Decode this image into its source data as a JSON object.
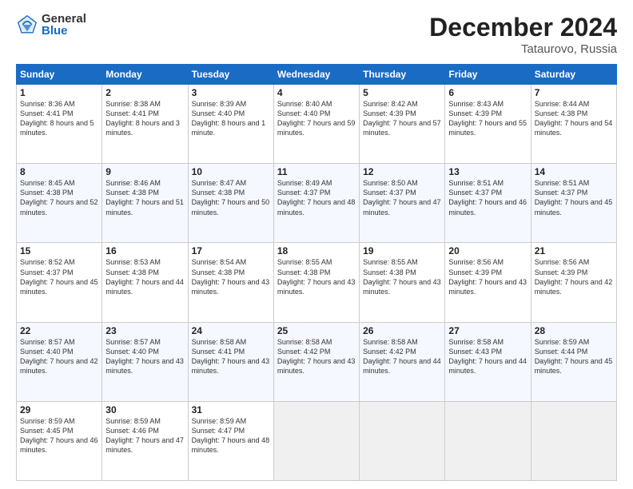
{
  "header": {
    "title": "December 2024",
    "subtitle": "Tataurovo, Russia",
    "logo_general": "General",
    "logo_blue": "Blue"
  },
  "days_of_week": [
    "Sunday",
    "Monday",
    "Tuesday",
    "Wednesday",
    "Thursday",
    "Friday",
    "Saturday"
  ],
  "weeks": [
    [
      {
        "day": "1",
        "sunrise": "8:36 AM",
        "sunset": "4:41 PM",
        "daylight": "8 hours and 5 minutes."
      },
      {
        "day": "2",
        "sunrise": "8:38 AM",
        "sunset": "4:41 PM",
        "daylight": "8 hours and 3 minutes."
      },
      {
        "day": "3",
        "sunrise": "8:39 AM",
        "sunset": "4:40 PM",
        "daylight": "8 hours and 1 minute."
      },
      {
        "day": "4",
        "sunrise": "8:40 AM",
        "sunset": "4:40 PM",
        "daylight": "7 hours and 59 minutes."
      },
      {
        "day": "5",
        "sunrise": "8:42 AM",
        "sunset": "4:39 PM",
        "daylight": "7 hours and 57 minutes."
      },
      {
        "day": "6",
        "sunrise": "8:43 AM",
        "sunset": "4:39 PM",
        "daylight": "7 hours and 55 minutes."
      },
      {
        "day": "7",
        "sunrise": "8:44 AM",
        "sunset": "4:38 PM",
        "daylight": "7 hours and 54 minutes."
      }
    ],
    [
      {
        "day": "8",
        "sunrise": "8:45 AM",
        "sunset": "4:38 PM",
        "daylight": "7 hours and 52 minutes."
      },
      {
        "day": "9",
        "sunrise": "8:46 AM",
        "sunset": "4:38 PM",
        "daylight": "7 hours and 51 minutes."
      },
      {
        "day": "10",
        "sunrise": "8:47 AM",
        "sunset": "4:38 PM",
        "daylight": "7 hours and 50 minutes."
      },
      {
        "day": "11",
        "sunrise": "8:49 AM",
        "sunset": "4:37 PM",
        "daylight": "7 hours and 48 minutes."
      },
      {
        "day": "12",
        "sunrise": "8:50 AM",
        "sunset": "4:37 PM",
        "daylight": "7 hours and 47 minutes."
      },
      {
        "day": "13",
        "sunrise": "8:51 AM",
        "sunset": "4:37 PM",
        "daylight": "7 hours and 46 minutes."
      },
      {
        "day": "14",
        "sunrise": "8:51 AM",
        "sunset": "4:37 PM",
        "daylight": "7 hours and 45 minutes."
      }
    ],
    [
      {
        "day": "15",
        "sunrise": "8:52 AM",
        "sunset": "4:37 PM",
        "daylight": "7 hours and 45 minutes."
      },
      {
        "day": "16",
        "sunrise": "8:53 AM",
        "sunset": "4:38 PM",
        "daylight": "7 hours and 44 minutes."
      },
      {
        "day": "17",
        "sunrise": "8:54 AM",
        "sunset": "4:38 PM",
        "daylight": "7 hours and 43 minutes."
      },
      {
        "day": "18",
        "sunrise": "8:55 AM",
        "sunset": "4:38 PM",
        "daylight": "7 hours and 43 minutes."
      },
      {
        "day": "19",
        "sunrise": "8:55 AM",
        "sunset": "4:38 PM",
        "daylight": "7 hours and 43 minutes."
      },
      {
        "day": "20",
        "sunrise": "8:56 AM",
        "sunset": "4:39 PM",
        "daylight": "7 hours and 43 minutes."
      },
      {
        "day": "21",
        "sunrise": "8:56 AM",
        "sunset": "4:39 PM",
        "daylight": "7 hours and 42 minutes."
      }
    ],
    [
      {
        "day": "22",
        "sunrise": "8:57 AM",
        "sunset": "4:40 PM",
        "daylight": "7 hours and 42 minutes."
      },
      {
        "day": "23",
        "sunrise": "8:57 AM",
        "sunset": "4:40 PM",
        "daylight": "7 hours and 43 minutes."
      },
      {
        "day": "24",
        "sunrise": "8:58 AM",
        "sunset": "4:41 PM",
        "daylight": "7 hours and 43 minutes."
      },
      {
        "day": "25",
        "sunrise": "8:58 AM",
        "sunset": "4:42 PM",
        "daylight": "7 hours and 43 minutes."
      },
      {
        "day": "26",
        "sunrise": "8:58 AM",
        "sunset": "4:42 PM",
        "daylight": "7 hours and 44 minutes."
      },
      {
        "day": "27",
        "sunrise": "8:58 AM",
        "sunset": "4:43 PM",
        "daylight": "7 hours and 44 minutes."
      },
      {
        "day": "28",
        "sunrise": "8:59 AM",
        "sunset": "4:44 PM",
        "daylight": "7 hours and 45 minutes."
      }
    ],
    [
      {
        "day": "29",
        "sunrise": "8:59 AM",
        "sunset": "4:45 PM",
        "daylight": "7 hours and 46 minutes."
      },
      {
        "day": "30",
        "sunrise": "8:59 AM",
        "sunset": "4:46 PM",
        "daylight": "7 hours and 47 minutes."
      },
      {
        "day": "31",
        "sunrise": "8:59 AM",
        "sunset": "4:47 PM",
        "daylight": "7 hours and 48 minutes."
      },
      null,
      null,
      null,
      null
    ]
  ]
}
